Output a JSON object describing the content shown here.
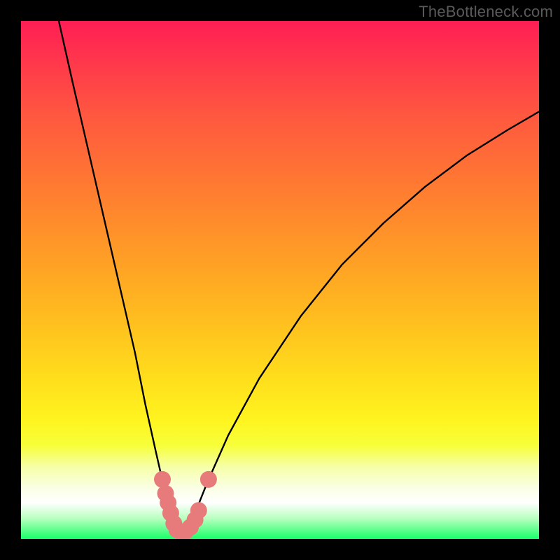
{
  "watermark": "TheBottleneck.com",
  "chart_data": {
    "type": "line",
    "title": "",
    "xlabel": "",
    "ylabel": "",
    "xlim": [
      0,
      100
    ],
    "ylim": [
      0,
      100
    ],
    "grid": false,
    "legend": false,
    "gradient_background": {
      "stops": [
        {
          "pos": 0.0,
          "color": "#ff1e54"
        },
        {
          "pos": 0.18,
          "color": "#ff5740"
        },
        {
          "pos": 0.38,
          "color": "#ff8a2c"
        },
        {
          "pos": 0.58,
          "color": "#ffbf1f"
        },
        {
          "pos": 0.77,
          "color": "#fff41f"
        },
        {
          "pos": 0.86,
          "color": "#f6ffa6"
        },
        {
          "pos": 0.93,
          "color": "#ffffff"
        },
        {
          "pos": 1.0,
          "color": "#18ff68"
        }
      ]
    },
    "series": [
      {
        "name": "bottleneck-curve",
        "color": "#000000",
        "x": [
          7.3,
          10,
          13,
          16,
          19,
          22,
          24,
          26,
          27.6,
          28.8,
          29.6,
          30.4,
          31.2,
          32.4,
          33.8,
          36,
          40,
          46,
          54,
          62,
          70,
          78,
          86,
          94,
          100
        ],
        "y": [
          100,
          88,
          75,
          62,
          49,
          36,
          26,
          17,
          10,
          5.5,
          2.5,
          1.3,
          1.3,
          2.5,
          5.5,
          11,
          20,
          31,
          43,
          53,
          61,
          68,
          74,
          79,
          82.5
        ]
      }
    ],
    "markers": [
      {
        "name": "marker-series",
        "color": "#e77a7a",
        "r": 12,
        "points": [
          {
            "x": 27.3,
            "y": 11.5
          },
          {
            "x": 27.9,
            "y": 8.8
          },
          {
            "x": 28.4,
            "y": 7.0
          },
          {
            "x": 28.9,
            "y": 5.0
          },
          {
            "x": 29.5,
            "y": 3.0
          },
          {
            "x": 30.1,
            "y": 1.8
          },
          {
            "x": 30.9,
            "y": 1.3
          },
          {
            "x": 31.8,
            "y": 1.5
          },
          {
            "x": 32.7,
            "y": 2.3
          },
          {
            "x": 33.6,
            "y": 3.7
          },
          {
            "x": 34.3,
            "y": 5.5
          },
          {
            "x": 36.2,
            "y": 11.5
          }
        ]
      }
    ]
  }
}
